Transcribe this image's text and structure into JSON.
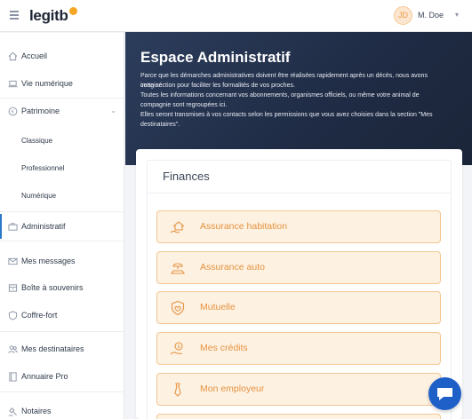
{
  "header": {
    "logo_text": "legitb",
    "avatar_initials": "JD",
    "user_name": "M. Doe"
  },
  "sidebar": {
    "items": [
      {
        "label": "Accueil",
        "icon": "home-icon"
      },
      {
        "label": "Vie numérique",
        "icon": "laptop-icon"
      },
      {
        "label": "Patrimoine",
        "icon": "coin-icon"
      },
      {
        "label": "Administratif",
        "icon": "briefcase-icon"
      },
      {
        "label": "Mes messages",
        "icon": "envelope-icon"
      },
      {
        "label": "Boîte à souvenirs",
        "icon": "box-icon"
      },
      {
        "label": "Coffre-fort",
        "icon": "shield-icon"
      },
      {
        "label": "Mes destinataires",
        "icon": "users-icon"
      },
      {
        "label": "Annuaire Pro",
        "icon": "book-icon"
      },
      {
        "label": "Notaires",
        "icon": "gavel-icon"
      }
    ],
    "patrimoine_sub": [
      "Classique",
      "Professionnel",
      "Numérique"
    ],
    "active": "Administratif"
  },
  "hero": {
    "title": "Espace Administratif",
    "lines": [
      "Parce que les démarches administratives doivent être réalisées rapidement après un décès, nous avons imaginé",
      "cette section pour faciliter les formalités de vos proches.",
      "Toutes les informations concernant vos abonnements, organismes officiels, ou même votre animal de",
      "compagnie sont regroupées ici.",
      "Elles seront transmises à vos contacts selon les permissions que vous avez choisies dans la section \"Mes",
      "destinataires\"."
    ]
  },
  "finances": {
    "title": "Finances",
    "items": [
      {
        "label": "Assurance habitation",
        "icon": "house-hand-icon"
      },
      {
        "label": "Assurance auto",
        "icon": "car-umbrella-icon"
      },
      {
        "label": "Mutuelle",
        "icon": "health-shield-icon"
      },
      {
        "label": "Mes crédits",
        "icon": "coin-hand-icon"
      },
      {
        "label": "Mon employeur",
        "icon": "tie-icon"
      }
    ]
  },
  "colors": {
    "accent": "#e5923f",
    "item_bg": "#fdf1e2",
    "item_border": "#f3c693",
    "hero_bg": "#23304b",
    "active": "#2a78c8",
    "chat": "#1e60c8"
  }
}
